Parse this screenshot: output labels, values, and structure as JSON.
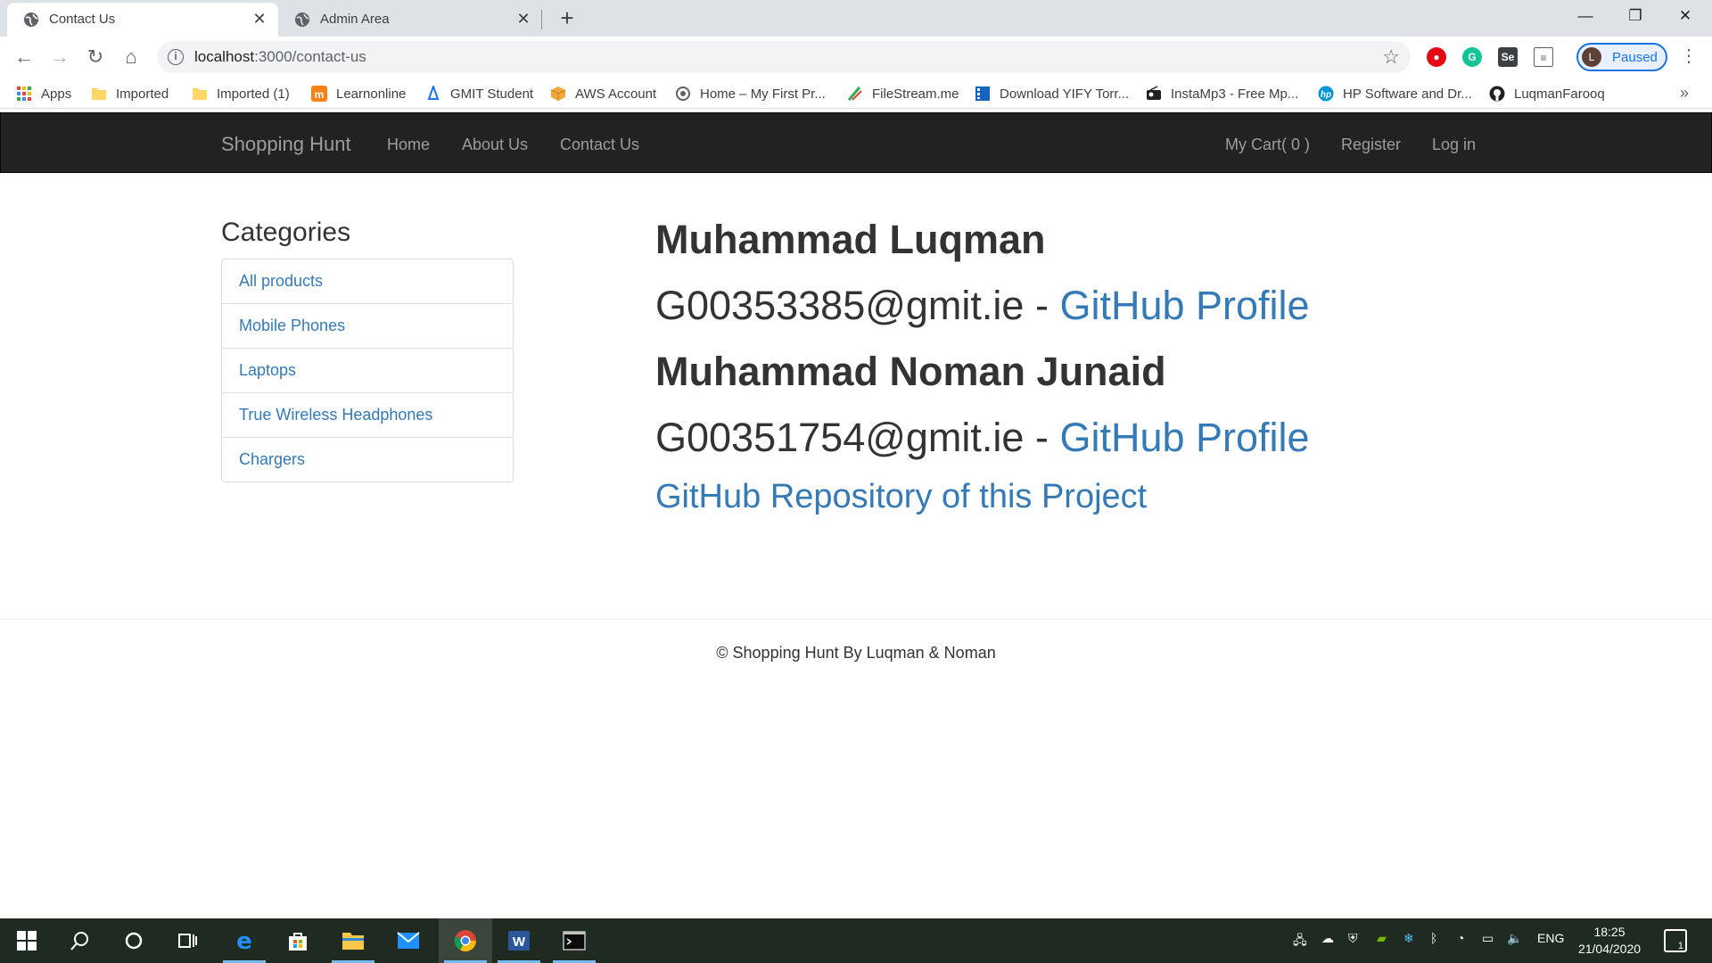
{
  "browser": {
    "tabs": [
      {
        "title": "Contact Us",
        "active": true
      },
      {
        "title": "Admin Area",
        "active": false
      }
    ],
    "address": {
      "host": "localhost",
      "path": ":3000/contact-us"
    },
    "profile": {
      "initial": "L",
      "status": "Paused"
    },
    "bookmarks": [
      {
        "label": "Apps",
        "icon": "apps-grid-icon",
        "color": "#ea4335"
      },
      {
        "label": "Imported",
        "icon": "folder-icon",
        "color": "#fdd663"
      },
      {
        "label": "Imported (1)",
        "icon": "folder-icon",
        "color": "#fdd663"
      },
      {
        "label": "Learnonline",
        "icon": "moodle-icon",
        "color": "#f98012"
      },
      {
        "label": "GMIT Student",
        "icon": "gmit-icon",
        "color": "#1a73e8"
      },
      {
        "label": "AWS Account",
        "icon": "aws-box-icon",
        "color": "#f2a93b"
      },
      {
        "label": "Home – My First Pr...",
        "icon": "site-icon",
        "color": "#5f6368"
      },
      {
        "label": "FileStream.me",
        "icon": "filestream-icon",
        "color": "#34a853"
      },
      {
        "label": "Download YIFY Torr...",
        "icon": "film-icon",
        "color": "#1565c0"
      },
      {
        "label": "InstaMp3 - Free Mp...",
        "icon": "radio-icon",
        "color": "#202124"
      },
      {
        "label": "HP Software and Dr...",
        "icon": "hp-icon",
        "color": "#0096d6"
      },
      {
        "label": "LuqmanFarooq",
        "icon": "github-icon",
        "color": "#202124"
      }
    ]
  },
  "navbar": {
    "brand": "Shopping Hunt",
    "left_links": [
      "Home",
      "About Us",
      "Contact Us"
    ],
    "right_links": [
      "My Cart( 0 )",
      "Register",
      "Log in"
    ]
  },
  "sidebar": {
    "title": "Categories",
    "items": [
      "All products",
      "Mobile Phones",
      "Laptops",
      "True Wireless Headphones",
      "Chargers"
    ]
  },
  "contacts": [
    {
      "name": "Muhammad Luqman",
      "email": "G00353385@gmit.ie",
      "separator": " - ",
      "link": "GitHub Profile"
    },
    {
      "name": "Muhammad Noman Junaid",
      "email": "G00351754@gmit.ie",
      "separator": " - ",
      "link": "GitHub Profile"
    }
  ],
  "repo_link": "GitHub Repository of this Project",
  "footer": "© Shopping Hunt By Luqman & Noman",
  "taskbar": {
    "tray_lang": "ENG",
    "time": "18:25",
    "date": "21/04/2020",
    "notifications": "1"
  },
  "colors": {
    "link": "#337ab7",
    "navbar_bg": "#222222",
    "taskbar_bg": "#1f2a20"
  }
}
